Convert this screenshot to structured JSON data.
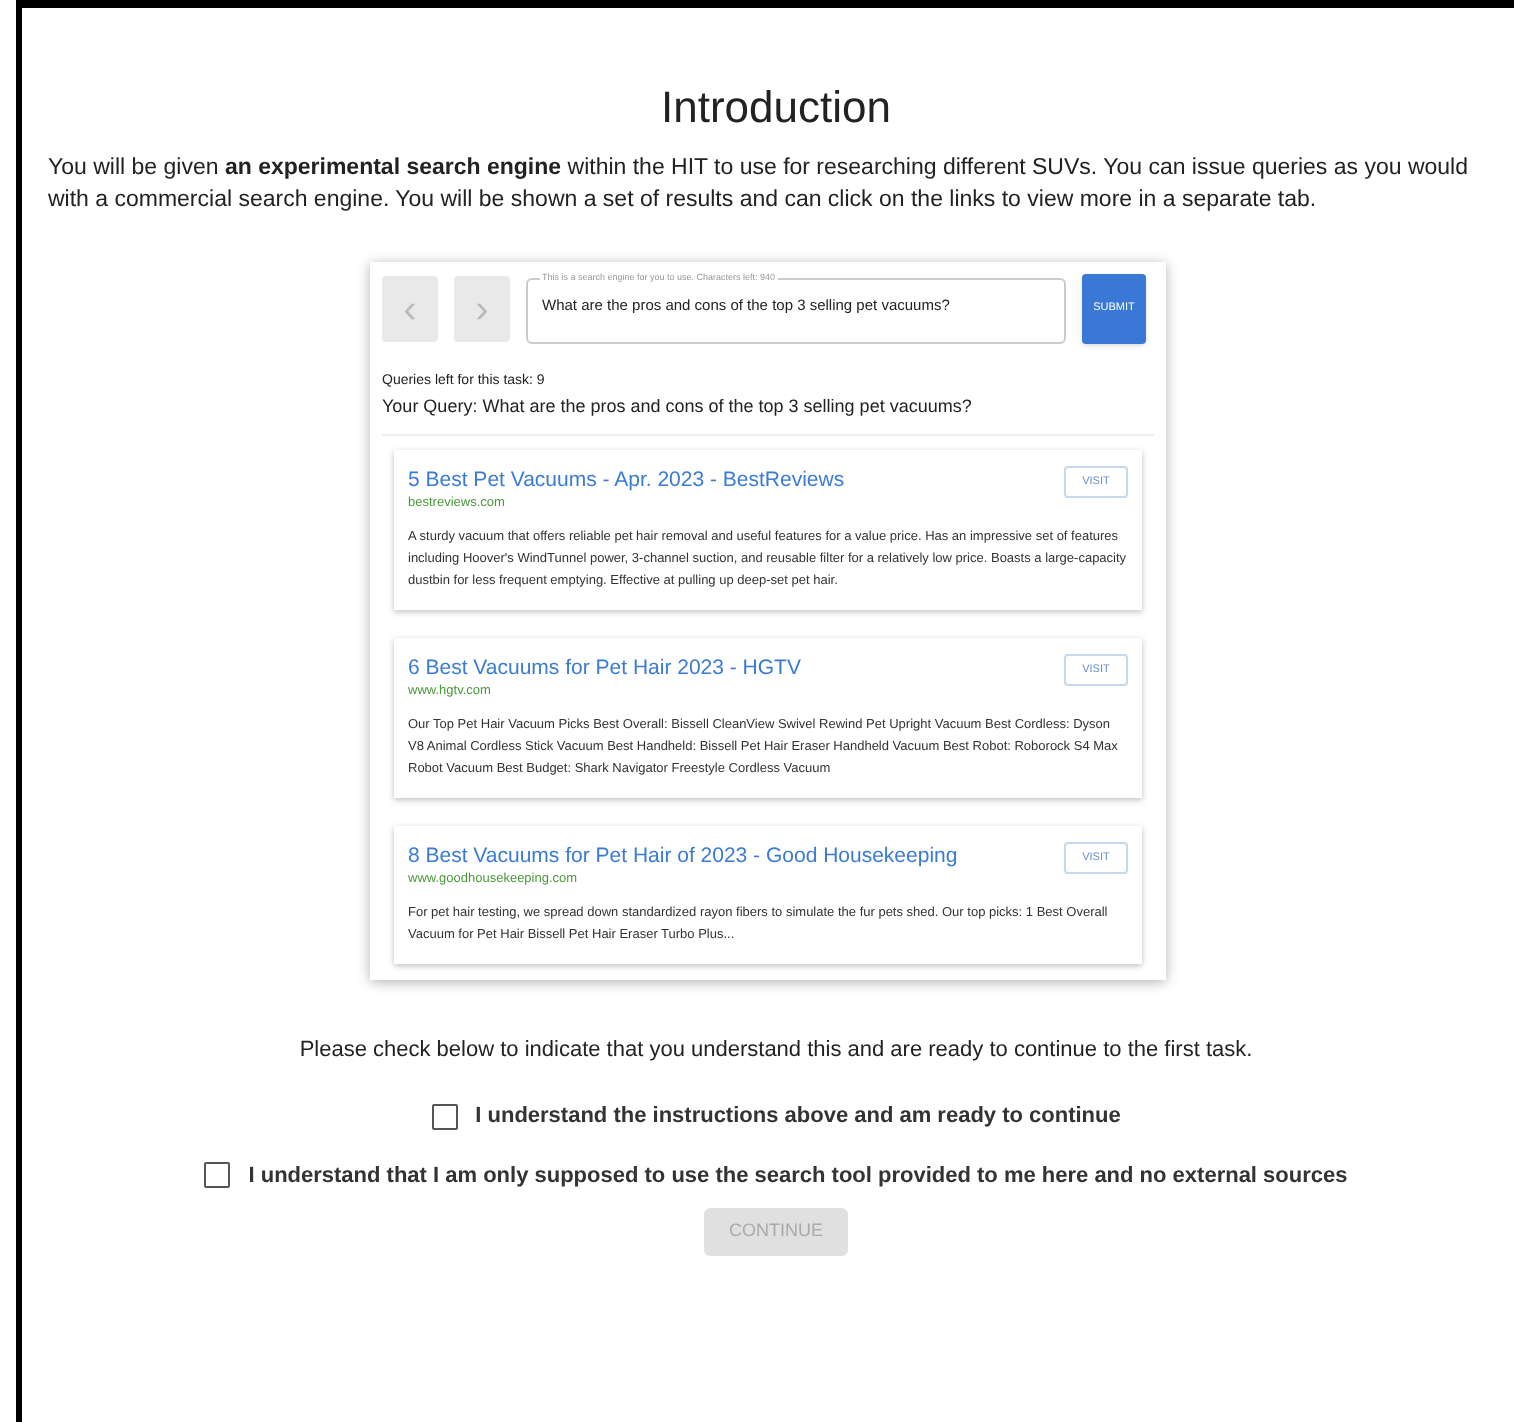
{
  "title": "Introduction",
  "intro": "You will be given **an experimental search engine** within the HIT to use for researching different SUVs. You can issue queries as you would with a commercial search engine. You will be shown a set of results and can click on the links to view more in a separate tab.",
  "search_engine": {
    "back": {
      "label": "‹",
      "disabled": true
    },
    "forward": {
      "label": "›",
      "disabled": true
    },
    "query_field": {
      "label": "This is a search engine for you to use. Characters left: 940",
      "value": "What are the pros and cons of the top 3 selling pet vacuums?"
    },
    "submit": "SUBMIT",
    "queries_left": "Queries left for this task: 9",
    "your_query": "Your Query: What are the pros and cons of the top 3 selling pet vacuums?",
    "results": [
      {
        "title": "5 Best Pet Vacuums - Apr. 2023 - BestReviews",
        "url": "bestreviews.com",
        "button": "VISIT",
        "snippet": "A sturdy vacuum that offers reliable pet hair removal and useful features for a value price. Has an impressive set of features including Hoover's WindTunnel power, 3-channel suction, and reusable filter for a relatively low price. Boasts a large-capacity dustbin for less frequent emptying. Effective at pulling up deep-set pet hair."
      },
      {
        "title": "6 Best Vacuums for Pet Hair 2023 - HGTV",
        "url": "www.hgtv.com",
        "button": "VISIT",
        "snippet": "Our Top Pet Hair Vacuum Picks Best Overall: Bissell CleanView Swivel Rewind Pet Upright Vacuum Best Cordless: Dyson V8 Animal Cordless Stick Vacuum Best Handheld: Bissell Pet Hair Eraser Handheld Vacuum Best Robot: Roborock S4 Max Robot Vacuum Best Budget: Shark Navigator Freestyle Cordless Vacuum"
      },
      {
        "title": "8 Best Vacuums for Pet Hair of 2023 - Good Housekeeping",
        "url": "www.goodhousekeeping.com",
        "button": "VISIT",
        "snippet": "For pet hair testing, we spread down standardized rayon fibers to simulate the fur pets shed. Our top picks: 1 Best Overall Vacuum for Pet Hair Bissell Pet Hair Eraser Turbo Plus..."
      }
    ]
  },
  "prompt": "Please check below to indicate that you understand this and are ready to continue to the first task.",
  "checkboxes": [
    {
      "label": "I understand the instructions above and am ready to continue",
      "checked": false
    },
    {
      "label": "I understand that I am only supposed to use the search tool provided to me here and no external sources",
      "checked": false
    }
  ],
  "continue": {
    "label": "CONTINUE",
    "disabled": true
  }
}
